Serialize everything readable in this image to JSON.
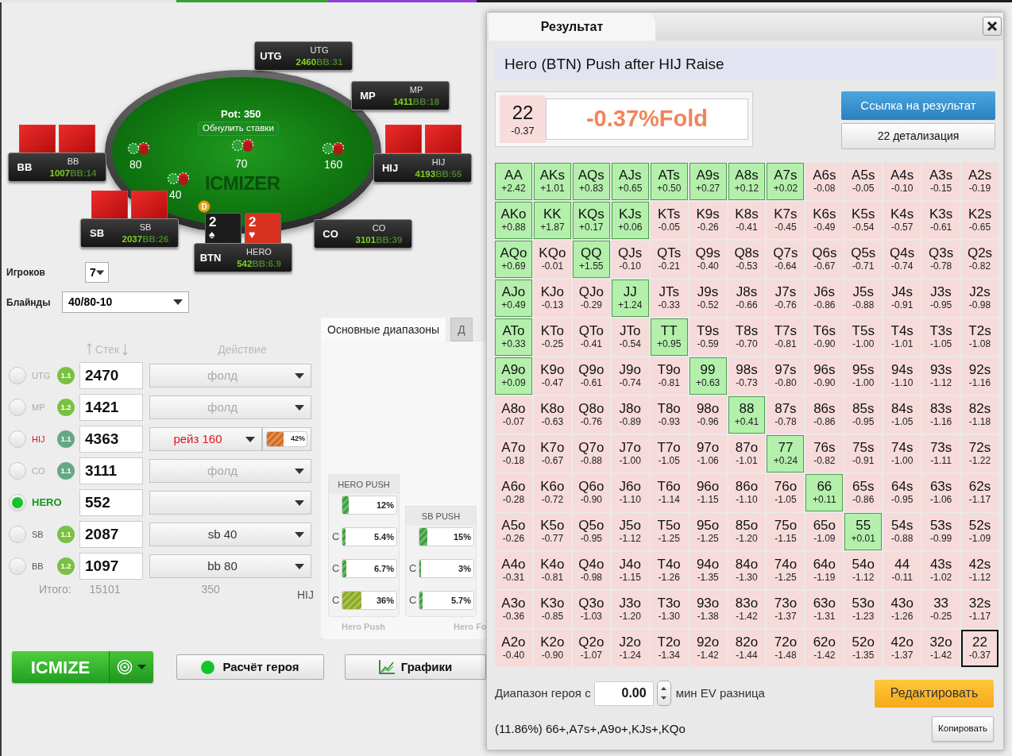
{
  "table": {
    "pot": "Pot: 350",
    "reset_button": "Обнулить ставки",
    "logo": "ICMIZER",
    "antes": "70",
    "dealer": "D",
    "seats": [
      {
        "position": "UTG",
        "name": "UTG",
        "stack": "2460",
        "bb": "BB:31"
      },
      {
        "position": "MP",
        "name": "MP",
        "stack": "1411",
        "bb": "BB:18"
      },
      {
        "position": "HIJ",
        "name": "HIJ",
        "stack": "4193",
        "bb": "BB:55",
        "bet": "160",
        "cards": [
          {
            "kind": "back"
          },
          {
            "kind": "back"
          }
        ]
      },
      {
        "position": "CO",
        "name": "CO",
        "stack": "3101",
        "bb": "BB:39"
      },
      {
        "position": "BTN",
        "name": "HERO",
        "stack": "542",
        "bb": "BB:6.9",
        "cards": [
          {
            "kind": "face",
            "rank": "2",
            "suit": "♠",
            "color": "#1c1c1c"
          },
          {
            "kind": "face",
            "rank": "2",
            "suit": "♥",
            "color": "#d8321e"
          }
        ]
      },
      {
        "position": "SB",
        "name": "SB",
        "stack": "2037",
        "bb": "BB:26",
        "bet": "40",
        "cards": [
          {
            "kind": "back"
          },
          {
            "kind": "back"
          }
        ]
      },
      {
        "position": "BB",
        "name": "BB",
        "stack": "1007",
        "bb": "BB:14",
        "bet": "80",
        "cards": [
          {
            "kind": "back"
          },
          {
            "kind": "back"
          }
        ]
      }
    ]
  },
  "settings": {
    "players_label": "Игроков",
    "players": "7",
    "blinds_label": "Блайнды",
    "blinds": "40/80-10"
  },
  "players": {
    "stack_header": "Стек",
    "action_header": "Действие",
    "rows": [
      {
        "position": "UTG",
        "selected": false,
        "badge": {
          "label": "1.1",
          "color": "#7ac143"
        },
        "stack": "2470",
        "action": "фолд",
        "kind": "fold"
      },
      {
        "position": "MP",
        "selected": false,
        "badge": {
          "label": "1.2",
          "color": "#7ac143"
        },
        "stack": "1421",
        "action": "фолд",
        "kind": "fold"
      },
      {
        "position": "HIJ",
        "selected": false,
        "badge": {
          "label": "1.1",
          "color": "#65a883"
        },
        "stack": "4363",
        "action": "рейз 160",
        "kind": "raise",
        "range": {
          "level": 0.42,
          "reading": "42%",
          "color": "#d2691e"
        }
      },
      {
        "position": "CO",
        "selected": false,
        "badge": {
          "label": "1.1",
          "color": "#65a883"
        },
        "stack": "3111",
        "action": "фолд",
        "kind": "fold"
      },
      {
        "position": "HERO",
        "selected": true,
        "stack": "552",
        "kind": "empty"
      },
      {
        "position": "SB",
        "selected": false,
        "badge": {
          "label": "1.1",
          "color": "#7ac143"
        },
        "stack": "2087",
        "action": "sb 40",
        "kind": "blind"
      },
      {
        "position": "BB",
        "selected": false,
        "badge": {
          "label": "1.2",
          "color": "#7ac143"
        },
        "stack": "1097",
        "action": "bb 80",
        "kind": "blind"
      }
    ],
    "total_label": "Итого:",
    "total_stack": "15101",
    "total_bets": "350",
    "side_label": "HIJ"
  },
  "ranges": {
    "tabs": [
      {
        "label": "Основные диапазоны",
        "selected": true
      },
      {
        "label": "Д",
        "selected": false
      }
    ],
    "columns": [
      {
        "title": "HERO PUSH",
        "bars": [
          {
            "level": 0.12,
            "reading": "12%",
            "color": "#3c9e3c"
          },
          {
            "prefix": "C",
            "level": 0.054,
            "reading": "5.4%",
            "color": "#3c9e3c"
          },
          {
            "prefix": "C",
            "level": 0.067,
            "reading": "6.7%",
            "color": "#3c9e3c"
          },
          {
            "prefix": "C",
            "level": 0.36,
            "reading": "36%",
            "color": "#8aaa1e"
          }
        ]
      },
      {
        "title": "SB PUSH",
        "bars": [
          {
            "level": 0.15,
            "reading": "15%",
            "color": "#3c9e3c"
          },
          {
            "prefix": "C",
            "level": 0.03,
            "reading": "3%",
            "color": "#3c9e3c"
          },
          {
            "prefix": "C",
            "level": 0.057,
            "reading": "5.7%",
            "color": "#3c9e3c"
          }
        ]
      }
    ],
    "footers": [
      "Hero Push",
      "Hero Fo"
    ]
  },
  "actions": {
    "icmize": "ICMIZE",
    "hero_calc": "Расчёт героя",
    "charts": "Графики"
  },
  "result": {
    "tab": "Результат",
    "title": "Hero (BTN) Push after HIJ Raise",
    "hand": "22",
    "hand_ev": "-0.37",
    "verdict": "-0.37%Fold",
    "link_button": "Ссылка на результат",
    "detail_button": "22 детализация",
    "grid": [
      {
        "cells": [
          {
            "hand": "AA",
            "ev": "+2.42",
            "in_range": true,
            "selected": false
          },
          {
            "hand": "AKs",
            "ev": "+1.01",
            "in_range": true,
            "selected": false
          },
          {
            "hand": "AQs",
            "ev": "+0.83",
            "in_range": true,
            "selected": false
          },
          {
            "hand": "AJs",
            "ev": "+0.65",
            "in_range": true,
            "selected": false
          },
          {
            "hand": "ATs",
            "ev": "+0.50",
            "in_range": true,
            "selected": false
          },
          {
            "hand": "A9s",
            "ev": "+0.27",
            "in_range": true,
            "selected": false
          },
          {
            "hand": "A8s",
            "ev": "+0.12",
            "in_range": true,
            "selected": false
          },
          {
            "hand": "A7s",
            "ev": "+0.02",
            "in_range": true,
            "selected": false
          },
          {
            "hand": "A6s",
            "ev": "-0.08",
            "in_range": false,
            "selected": false
          },
          {
            "hand": "A5s",
            "ev": "-0.05",
            "in_range": false,
            "selected": false
          },
          {
            "hand": "A4s",
            "ev": "-0.10",
            "in_range": false,
            "selected": false
          },
          {
            "hand": "A3s",
            "ev": "-0.15",
            "in_range": false,
            "selected": false
          },
          {
            "hand": "A2s",
            "ev": "-0.19",
            "in_range": false,
            "selected": false
          }
        ]
      },
      {
        "cells": [
          {
            "hand": "AKo",
            "ev": "+0.88",
            "in_range": true,
            "selected": false
          },
          {
            "hand": "KK",
            "ev": "+1.87",
            "in_range": true,
            "selected": false
          },
          {
            "hand": "KQs",
            "ev": "+0.17",
            "in_range": true,
            "selected": false
          },
          {
            "hand": "KJs",
            "ev": "+0.06",
            "in_range": true,
            "selected": false
          },
          {
            "hand": "KTs",
            "ev": "-0.05",
            "in_range": false,
            "selected": false
          },
          {
            "hand": "K9s",
            "ev": "-0.26",
            "in_range": false,
            "selected": false
          },
          {
            "hand": "K8s",
            "ev": "-0.41",
            "in_range": false,
            "selected": false
          },
          {
            "hand": "K7s",
            "ev": "-0.45",
            "in_range": false,
            "selected": false
          },
          {
            "hand": "K6s",
            "ev": "-0.49",
            "in_range": false,
            "selected": false
          },
          {
            "hand": "K5s",
            "ev": "-0.54",
            "in_range": false,
            "selected": false
          },
          {
            "hand": "K4s",
            "ev": "-0.57",
            "in_range": false,
            "selected": false
          },
          {
            "hand": "K3s",
            "ev": "-0.61",
            "in_range": false,
            "selected": false
          },
          {
            "hand": "K2s",
            "ev": "-0.65",
            "in_range": false,
            "selected": false
          }
        ]
      },
      {
        "cells": [
          {
            "hand": "AQo",
            "ev": "+0.69",
            "in_range": true,
            "selected": false
          },
          {
            "hand": "KQo",
            "ev": "-0.01",
            "in_range": false,
            "selected": false
          },
          {
            "hand": "QQ",
            "ev": "+1.55",
            "in_range": true,
            "selected": false
          },
          {
            "hand": "QJs",
            "ev": "-0.10",
            "in_range": false,
            "selected": false
          },
          {
            "hand": "QTs",
            "ev": "-0.21",
            "in_range": false,
            "selected": false
          },
          {
            "hand": "Q9s",
            "ev": "-0.40",
            "in_range": false,
            "selected": false
          },
          {
            "hand": "Q8s",
            "ev": "-0.53",
            "in_range": false,
            "selected": false
          },
          {
            "hand": "Q7s",
            "ev": "-0.64",
            "in_range": false,
            "selected": false
          },
          {
            "hand": "Q6s",
            "ev": "-0.67",
            "in_range": false,
            "selected": false
          },
          {
            "hand": "Q5s",
            "ev": "-0.71",
            "in_range": false,
            "selected": false
          },
          {
            "hand": "Q4s",
            "ev": "-0.74",
            "in_range": false,
            "selected": false
          },
          {
            "hand": "Q3s",
            "ev": "-0.78",
            "in_range": false,
            "selected": false
          },
          {
            "hand": "Q2s",
            "ev": "-0.82",
            "in_range": false,
            "selected": false
          }
        ]
      },
      {
        "cells": [
          {
            "hand": "AJo",
            "ev": "+0.49",
            "in_range": true,
            "selected": false
          },
          {
            "hand": "KJo",
            "ev": "-0.13",
            "in_range": false,
            "selected": false
          },
          {
            "hand": "QJo",
            "ev": "-0.29",
            "in_range": false,
            "selected": false
          },
          {
            "hand": "JJ",
            "ev": "+1.24",
            "in_range": true,
            "selected": false
          },
          {
            "hand": "JTs",
            "ev": "-0.33",
            "in_range": false,
            "selected": false
          },
          {
            "hand": "J9s",
            "ev": "-0.52",
            "in_range": false,
            "selected": false
          },
          {
            "hand": "J8s",
            "ev": "-0.66",
            "in_range": false,
            "selected": false
          },
          {
            "hand": "J7s",
            "ev": "-0.76",
            "in_range": false,
            "selected": false
          },
          {
            "hand": "J6s",
            "ev": "-0.86",
            "in_range": false,
            "selected": false
          },
          {
            "hand": "J5s",
            "ev": "-0.88",
            "in_range": false,
            "selected": false
          },
          {
            "hand": "J4s",
            "ev": "-0.91",
            "in_range": false,
            "selected": false
          },
          {
            "hand": "J3s",
            "ev": "-0.95",
            "in_range": false,
            "selected": false
          },
          {
            "hand": "J2s",
            "ev": "-0.98",
            "in_range": false,
            "selected": false
          }
        ]
      },
      {
        "cells": [
          {
            "hand": "ATo",
            "ev": "+0.33",
            "in_range": true,
            "selected": false
          },
          {
            "hand": "KTo",
            "ev": "-0.25",
            "in_range": false,
            "selected": false
          },
          {
            "hand": "QTo",
            "ev": "-0.41",
            "in_range": false,
            "selected": false
          },
          {
            "hand": "JTo",
            "ev": "-0.54",
            "in_range": false,
            "selected": false
          },
          {
            "hand": "TT",
            "ev": "+0.95",
            "in_range": true,
            "selected": false
          },
          {
            "hand": "T9s",
            "ev": "-0.59",
            "in_range": false,
            "selected": false
          },
          {
            "hand": "T8s",
            "ev": "-0.70",
            "in_range": false,
            "selected": false
          },
          {
            "hand": "T7s",
            "ev": "-0.81",
            "in_range": false,
            "selected": false
          },
          {
            "hand": "T6s",
            "ev": "-0.90",
            "in_range": false,
            "selected": false
          },
          {
            "hand": "T5s",
            "ev": "-1.00",
            "in_range": false,
            "selected": false
          },
          {
            "hand": "T4s",
            "ev": "-1.01",
            "in_range": false,
            "selected": false
          },
          {
            "hand": "T3s",
            "ev": "-1.05",
            "in_range": false,
            "selected": false
          },
          {
            "hand": "T2s",
            "ev": "-1.08",
            "in_range": false,
            "selected": false
          }
        ]
      },
      {
        "cells": [
          {
            "hand": "A9o",
            "ev": "+0.09",
            "in_range": true,
            "selected": false
          },
          {
            "hand": "K9o",
            "ev": "-0.47",
            "in_range": false,
            "selected": false
          },
          {
            "hand": "Q9o",
            "ev": "-0.61",
            "in_range": false,
            "selected": false
          },
          {
            "hand": "J9o",
            "ev": "-0.74",
            "in_range": false,
            "selected": false
          },
          {
            "hand": "T9o",
            "ev": "-0.81",
            "in_range": false,
            "selected": false
          },
          {
            "hand": "99",
            "ev": "+0.63",
            "in_range": true,
            "selected": false
          },
          {
            "hand": "98s",
            "ev": "-0.73",
            "in_range": false,
            "selected": false
          },
          {
            "hand": "97s",
            "ev": "-0.80",
            "in_range": false,
            "selected": false
          },
          {
            "hand": "96s",
            "ev": "-0.90",
            "in_range": false,
            "selected": false
          },
          {
            "hand": "95s",
            "ev": "-1.00",
            "in_range": false,
            "selected": false
          },
          {
            "hand": "94s",
            "ev": "-1.10",
            "in_range": false,
            "selected": false
          },
          {
            "hand": "93s",
            "ev": "-1.12",
            "in_range": false,
            "selected": false
          },
          {
            "hand": "92s",
            "ev": "-1.16",
            "in_range": false,
            "selected": false
          }
        ]
      },
      {
        "cells": [
          {
            "hand": "A8o",
            "ev": "-0.07",
            "in_range": false,
            "selected": false
          },
          {
            "hand": "K8o",
            "ev": "-0.63",
            "in_range": false,
            "selected": false
          },
          {
            "hand": "Q8o",
            "ev": "-0.76",
            "in_range": false,
            "selected": false
          },
          {
            "hand": "J8o",
            "ev": "-0.89",
            "in_range": false,
            "selected": false
          },
          {
            "hand": "T8o",
            "ev": "-0.93",
            "in_range": false,
            "selected": false
          },
          {
            "hand": "98o",
            "ev": "-0.96",
            "in_range": false,
            "selected": false
          },
          {
            "hand": "88",
            "ev": "+0.41",
            "in_range": true,
            "selected": false
          },
          {
            "hand": "87s",
            "ev": "-0.78",
            "in_range": false,
            "selected": false
          },
          {
            "hand": "86s",
            "ev": "-0.86",
            "in_range": false,
            "selected": false
          },
          {
            "hand": "85s",
            "ev": "-0.95",
            "in_range": false,
            "selected": false
          },
          {
            "hand": "84s",
            "ev": "-1.05",
            "in_range": false,
            "selected": false
          },
          {
            "hand": "83s",
            "ev": "-1.16",
            "in_range": false,
            "selected": false
          },
          {
            "hand": "82s",
            "ev": "-1.18",
            "in_range": false,
            "selected": false
          }
        ]
      },
      {
        "cells": [
          {
            "hand": "A7o",
            "ev": "-0.18",
            "in_range": false,
            "selected": false
          },
          {
            "hand": "K7o",
            "ev": "-0.67",
            "in_range": false,
            "selected": false
          },
          {
            "hand": "Q7o",
            "ev": "-0.88",
            "in_range": false,
            "selected": false
          },
          {
            "hand": "J7o",
            "ev": "-1.00",
            "in_range": false,
            "selected": false
          },
          {
            "hand": "T7o",
            "ev": "-1.05",
            "in_range": false,
            "selected": false
          },
          {
            "hand": "97o",
            "ev": "-1.06",
            "in_range": false,
            "selected": false
          },
          {
            "hand": "87o",
            "ev": "-1.01",
            "in_range": false,
            "selected": false
          },
          {
            "hand": "77",
            "ev": "+0.24",
            "in_range": true,
            "selected": false
          },
          {
            "hand": "76s",
            "ev": "-0.82",
            "in_range": false,
            "selected": false
          },
          {
            "hand": "75s",
            "ev": "-0.91",
            "in_range": false,
            "selected": false
          },
          {
            "hand": "74s",
            "ev": "-1.00",
            "in_range": false,
            "selected": false
          },
          {
            "hand": "73s",
            "ev": "-1.11",
            "in_range": false,
            "selected": false
          },
          {
            "hand": "72s",
            "ev": "-1.22",
            "in_range": false,
            "selected": false
          }
        ]
      },
      {
        "cells": [
          {
            "hand": "A6o",
            "ev": "-0.28",
            "in_range": false,
            "selected": false
          },
          {
            "hand": "K6o",
            "ev": "-0.72",
            "in_range": false,
            "selected": false
          },
          {
            "hand": "Q6o",
            "ev": "-0.90",
            "in_range": false,
            "selected": false
          },
          {
            "hand": "J6o",
            "ev": "-1.10",
            "in_range": false,
            "selected": false
          },
          {
            "hand": "T6o",
            "ev": "-1.14",
            "in_range": false,
            "selected": false
          },
          {
            "hand": "96o",
            "ev": "-1.15",
            "in_range": false,
            "selected": false
          },
          {
            "hand": "86o",
            "ev": "-1.10",
            "in_range": false,
            "selected": false
          },
          {
            "hand": "76o",
            "ev": "-1.05",
            "in_range": false,
            "selected": false
          },
          {
            "hand": "66",
            "ev": "+0.11",
            "in_range": true,
            "selected": false
          },
          {
            "hand": "65s",
            "ev": "-0.86",
            "in_range": false,
            "selected": false
          },
          {
            "hand": "64s",
            "ev": "-0.95",
            "in_range": false,
            "selected": false
          },
          {
            "hand": "63s",
            "ev": "-1.06",
            "in_range": false,
            "selected": false
          },
          {
            "hand": "62s",
            "ev": "-1.17",
            "in_range": false,
            "selected": false
          }
        ]
      },
      {
        "cells": [
          {
            "hand": "A5o",
            "ev": "-0.26",
            "in_range": false,
            "selected": false
          },
          {
            "hand": "K5o",
            "ev": "-0.77",
            "in_range": false,
            "selected": false
          },
          {
            "hand": "Q5o",
            "ev": "-0.95",
            "in_range": false,
            "selected": false
          },
          {
            "hand": "J5o",
            "ev": "-1.12",
            "in_range": false,
            "selected": false
          },
          {
            "hand": "T5o",
            "ev": "-1.25",
            "in_range": false,
            "selected": false
          },
          {
            "hand": "95o",
            "ev": "-1.25",
            "in_range": false,
            "selected": false
          },
          {
            "hand": "85o",
            "ev": "-1.20",
            "in_range": false,
            "selected": false
          },
          {
            "hand": "75o",
            "ev": "-1.15",
            "in_range": false,
            "selected": false
          },
          {
            "hand": "65o",
            "ev": "-1.09",
            "in_range": false,
            "selected": false
          },
          {
            "hand": "55",
            "ev": "+0.01",
            "in_range": true,
            "selected": false
          },
          {
            "hand": "54s",
            "ev": "-0.88",
            "in_range": false,
            "selected": false
          },
          {
            "hand": "53s",
            "ev": "-0.99",
            "in_range": false,
            "selected": false
          },
          {
            "hand": "52s",
            "ev": "-1.09",
            "in_range": false,
            "selected": false
          }
        ]
      },
      {
        "cells": [
          {
            "hand": "A4o",
            "ev": "-0.31",
            "in_range": false,
            "selected": false
          },
          {
            "hand": "K4o",
            "ev": "-0.81",
            "in_range": false,
            "selected": false
          },
          {
            "hand": "Q4o",
            "ev": "-0.98",
            "in_range": false,
            "selected": false
          },
          {
            "hand": "J4o",
            "ev": "-1.15",
            "in_range": false,
            "selected": false
          },
          {
            "hand": "T4o",
            "ev": "-1.26",
            "in_range": false,
            "selected": false
          },
          {
            "hand": "94o",
            "ev": "-1.35",
            "in_range": false,
            "selected": false
          },
          {
            "hand": "84o",
            "ev": "-1.30",
            "in_range": false,
            "selected": false
          },
          {
            "hand": "74o",
            "ev": "-1.25",
            "in_range": false,
            "selected": false
          },
          {
            "hand": "64o",
            "ev": "-1.19",
            "in_range": false,
            "selected": false
          },
          {
            "hand": "54o",
            "ev": "-1.12",
            "in_range": false,
            "selected": false
          },
          {
            "hand": "44",
            "ev": "-0.11",
            "in_range": false,
            "selected": false
          },
          {
            "hand": "43s",
            "ev": "-1.02",
            "in_range": false,
            "selected": false
          },
          {
            "hand": "42s",
            "ev": "-1.12",
            "in_range": false,
            "selected": false
          }
        ]
      },
      {
        "cells": [
          {
            "hand": "A3o",
            "ev": "-0.36",
            "in_range": false,
            "selected": false
          },
          {
            "hand": "K3o",
            "ev": "-0.85",
            "in_range": false,
            "selected": false
          },
          {
            "hand": "Q3o",
            "ev": "-1.03",
            "in_range": false,
            "selected": false
          },
          {
            "hand": "J3o",
            "ev": "-1.20",
            "in_range": false,
            "selected": false
          },
          {
            "hand": "T3o",
            "ev": "-1.30",
            "in_range": false,
            "selected": false
          },
          {
            "hand": "93o",
            "ev": "-1.38",
            "in_range": false,
            "selected": false
          },
          {
            "hand": "83o",
            "ev": "-1.42",
            "in_range": false,
            "selected": false
          },
          {
            "hand": "73o",
            "ev": "-1.37",
            "in_range": false,
            "selected": false
          },
          {
            "hand": "63o",
            "ev": "-1.31",
            "in_range": false,
            "selected": false
          },
          {
            "hand": "53o",
            "ev": "-1.23",
            "in_range": false,
            "selected": false
          },
          {
            "hand": "43o",
            "ev": "-1.26",
            "in_range": false,
            "selected": false
          },
          {
            "hand": "33",
            "ev": "-0.25",
            "in_range": false,
            "selected": false
          },
          {
            "hand": "32s",
            "ev": "-1.17",
            "in_range": false,
            "selected": false
          }
        ]
      },
      {
        "cells": [
          {
            "hand": "A2o",
            "ev": "-0.40",
            "in_range": false,
            "selected": false
          },
          {
            "hand": "K2o",
            "ev": "-0.90",
            "in_range": false,
            "selected": false
          },
          {
            "hand": "Q2o",
            "ev": "-1.07",
            "in_range": false,
            "selected": false
          },
          {
            "hand": "J2o",
            "ev": "-1.24",
            "in_range": false,
            "selected": false
          },
          {
            "hand": "T2o",
            "ev": "-1.34",
            "in_range": false,
            "selected": false
          },
          {
            "hand": "92o",
            "ev": "-1.42",
            "in_range": false,
            "selected": false
          },
          {
            "hand": "82o",
            "ev": "-1.44",
            "in_range": false,
            "selected": false
          },
          {
            "hand": "72o",
            "ev": "-1.48",
            "in_range": false,
            "selected": false
          },
          {
            "hand": "62o",
            "ev": "-1.42",
            "in_range": false,
            "selected": false
          },
          {
            "hand": "52o",
            "ev": "-1.35",
            "in_range": false,
            "selected": false
          },
          {
            "hand": "42o",
            "ev": "-1.37",
            "in_range": false,
            "selected": false
          },
          {
            "hand": "32o",
            "ev": "-1.42",
            "in_range": false,
            "selected": false
          },
          {
            "hand": "22",
            "ev": "-0.37",
            "in_range": false,
            "selected": true
          }
        ]
      }
    ],
    "filter_label": "Диапазон героя с",
    "filter_value": "0.00",
    "filter_unit": "мин EV разница",
    "edit_button": "Редактировать",
    "range_text": "(11.86%) 66+,A7s+,A9o+,KJs+,KQo",
    "copy_button": "Копировать"
  }
}
